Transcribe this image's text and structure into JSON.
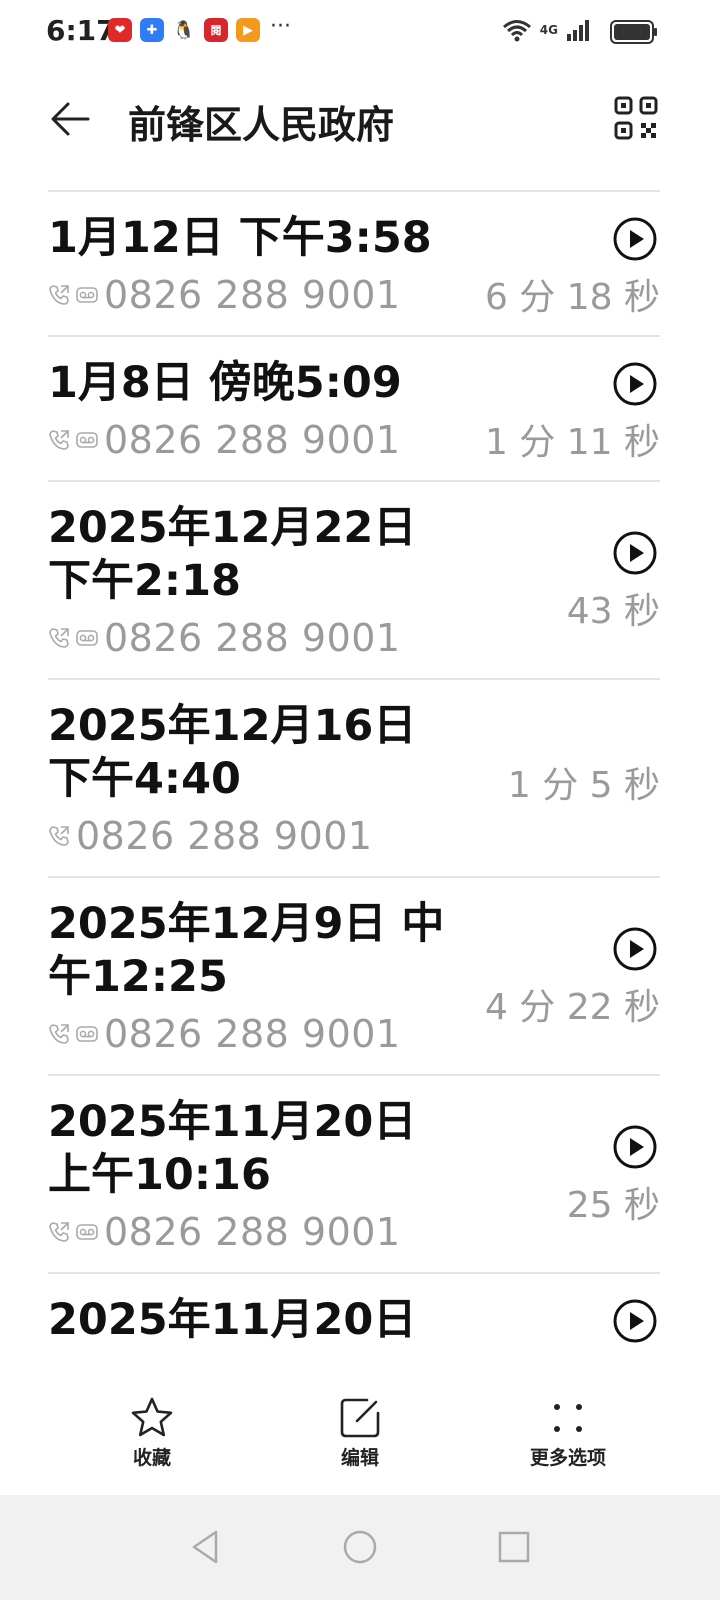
{
  "status": {
    "time": "6:17",
    "more": "···",
    "net": "4G"
  },
  "header": {
    "title": "前锋区人民政府"
  },
  "calls": [
    {
      "date": "1月12日 下午3:58",
      "number": "0826 288 9001",
      "duration": "6 分 18 秒",
      "voicemail": true
    },
    {
      "date": "1月8日 傍晚5:09",
      "number": "0826 288 9001",
      "duration": "1 分 11 秒",
      "voicemail": true
    },
    {
      "date": "2025年12月22日 下午2:18",
      "number": "0826 288 9001",
      "duration": "43 秒",
      "voicemail": true
    },
    {
      "date": "2025年12月16日 下午4:40",
      "number": "0826 288 9001",
      "duration": "1 分 5 秒",
      "voicemail": false
    },
    {
      "date": "2025年12月9日 中午12:25",
      "number": "0826 288 9001",
      "duration": "4 分 22 秒",
      "voicemail": true
    },
    {
      "date": "2025年11月20日 上午10:16",
      "number": "0826 288 9001",
      "duration": "25 秒",
      "voicemail": true
    },
    {
      "date": "2025年11月20日",
      "number": "",
      "duration": "",
      "voicemail": true
    }
  ],
  "bottom": {
    "favorite_label": "收藏",
    "edit_label": "编辑",
    "more_label": "更多选项"
  }
}
